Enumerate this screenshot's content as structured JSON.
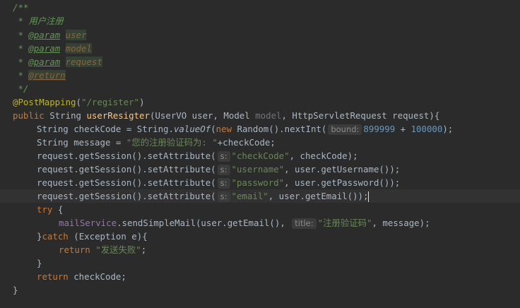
{
  "editor": {
    "doc_open": "/**",
    "doc_star": " * ",
    "doc_desc": "用户注册",
    "tag_param": "@param",
    "tag_return": "@return",
    "param_user": "user",
    "param_model": "model",
    "param_request": "request",
    "doc_close": " */",
    "annotation": "@PostMapping",
    "mapping_path": "\"/register\"",
    "kw_public": "public",
    "kw_new": "new",
    "kw_try": "try",
    "kw_catch": "catch",
    "kw_return": "return",
    "method_name": "userResigter",
    "hint_bound": "bound:",
    "hint_s": "s:",
    "hint_title": "title:",
    "num_bound": "899999",
    "num_add": "100000",
    "str_message": "\"您的注册验证码为: \"",
    "str_checkCode": "\"checkCode\"",
    "str_username": "\"username\"",
    "str_password": "\"password\"",
    "str_email": "\"email\"",
    "str_title": "\"注册验证码\"",
    "str_fail": "\"发送失败\"",
    "field_mailService": "mailService",
    "static_valueOf": "valueOf",
    "line6_a": " String ",
    "line6_b": "(UserVO user, Model ",
    "line6_c": ", HttpServletRequest request){",
    "line7_a": "String checkCode = String.",
    "line7_b": "(",
    "line7_c": " Random().nextInt(",
    "line7_d": " + ",
    "line7_e": ");",
    "line8_a": "String message = ",
    "line8_b": "+checkCode;",
    "setattr": "request.getSession().setAttribute(",
    "line9_b": ", checkCode);",
    "line10_b": ", user.getUsername());",
    "line11_b": ", user.getPassword());",
    "line12_b": ", user.getEmail());",
    "try_brace": " {",
    "line14_b": ".sendSimpleMail(user.getEmail(),",
    "line14_c": ", message);",
    "catch_pre": "}",
    "catch_post": " (Exception e){",
    "return_fail_end": ";",
    "close_brace": "}",
    "return_code": " checkCode;"
  }
}
